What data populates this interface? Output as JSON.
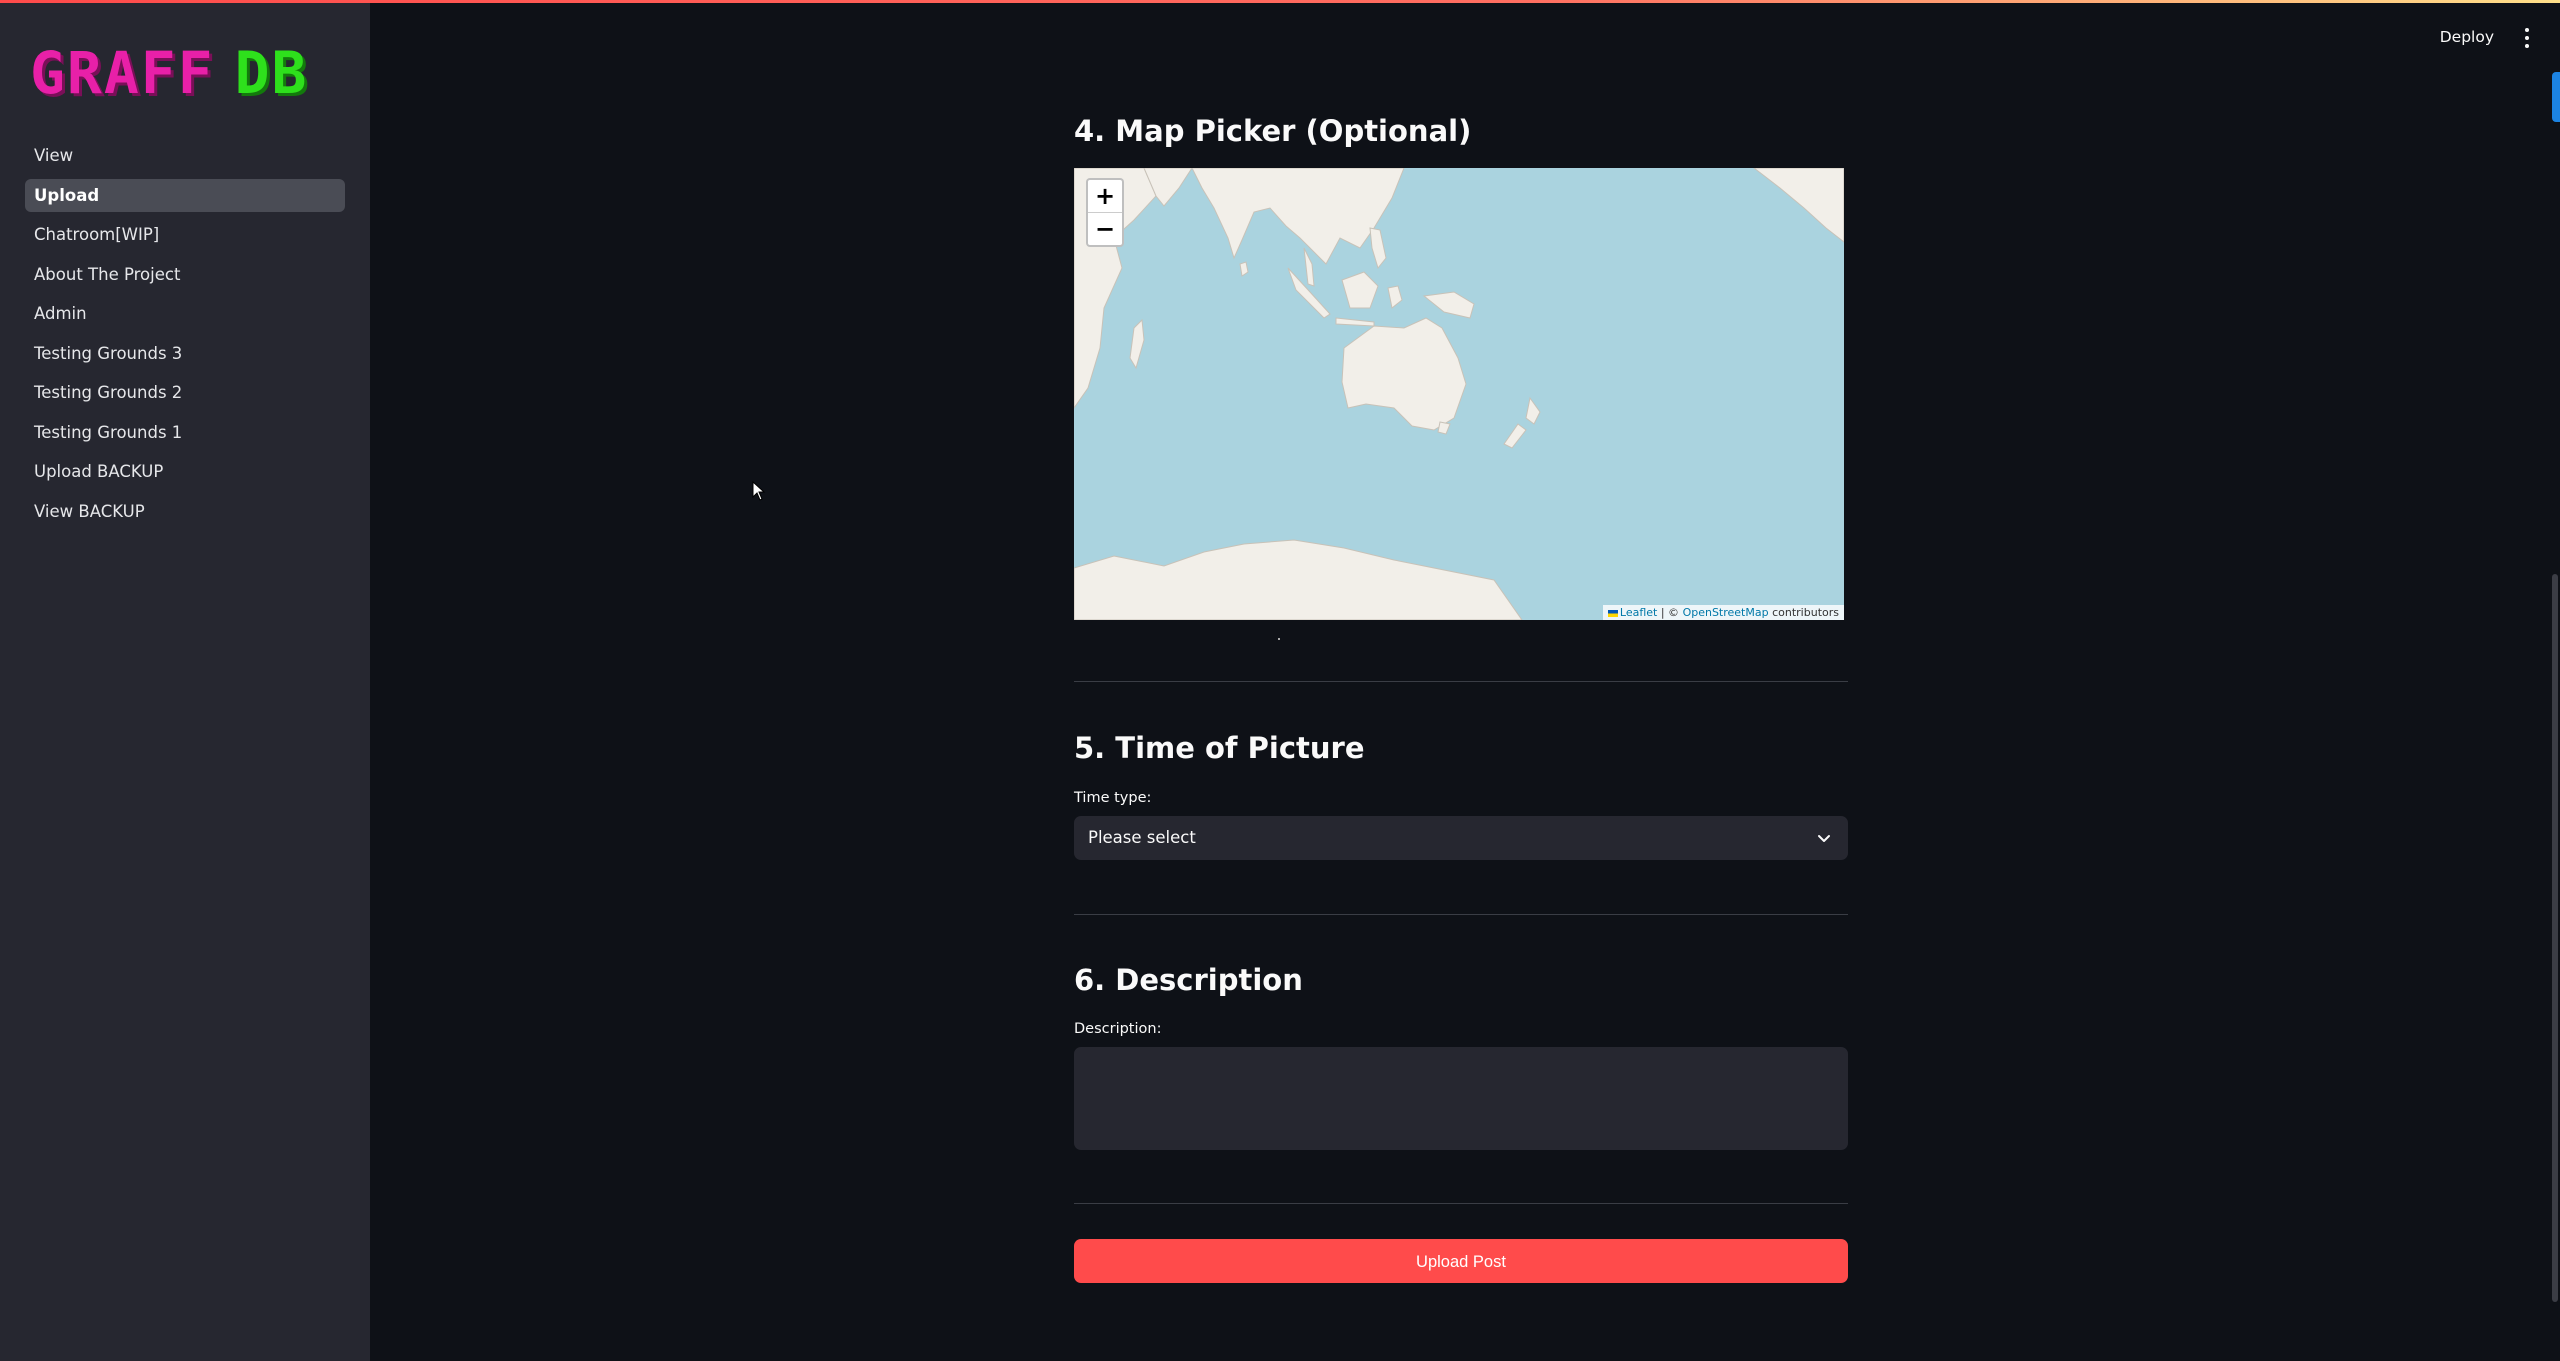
{
  "colors": {
    "background": "#0e1117",
    "sidebar": "#262730",
    "accent": "#ff4b4b",
    "logo_primary": "#e820a8",
    "logo_secondary": "#2ee01c",
    "map_water": "#aad3df",
    "map_land": "#f2efe9"
  },
  "logo": {
    "part1": "GRAFF",
    "part2": "DB"
  },
  "sidebar": {
    "items": [
      {
        "label": "View",
        "active": false
      },
      {
        "label": "Upload",
        "active": true
      },
      {
        "label": "Chatroom[WIP]",
        "active": false
      },
      {
        "label": "About The Project",
        "active": false
      },
      {
        "label": "Admin",
        "active": false
      },
      {
        "label": "Testing Grounds 3",
        "active": false
      },
      {
        "label": "Testing Grounds 2",
        "active": false
      },
      {
        "label": "Testing Grounds 1",
        "active": false
      },
      {
        "label": "Upload BACKUP",
        "active": false
      },
      {
        "label": "View BACKUP",
        "active": false
      }
    ]
  },
  "header": {
    "deploy_label": "Deploy",
    "menu_icon": "vertical-dots-icon"
  },
  "map_section": {
    "title": "4. Map Picker (Optional)",
    "zoom_in": "+",
    "zoom_out": "−",
    "attribution": {
      "leaflet": "Leaflet",
      "separator": "| ©",
      "osm": "OpenStreetMap",
      "contributors": "contributors"
    }
  },
  "time_section": {
    "title": "5. Time of Picture",
    "label": "Time type:",
    "selected": "Please select"
  },
  "description_section": {
    "title": "6. Description",
    "label": "Description:",
    "value": ""
  },
  "submit": {
    "label": "Upload Post"
  }
}
